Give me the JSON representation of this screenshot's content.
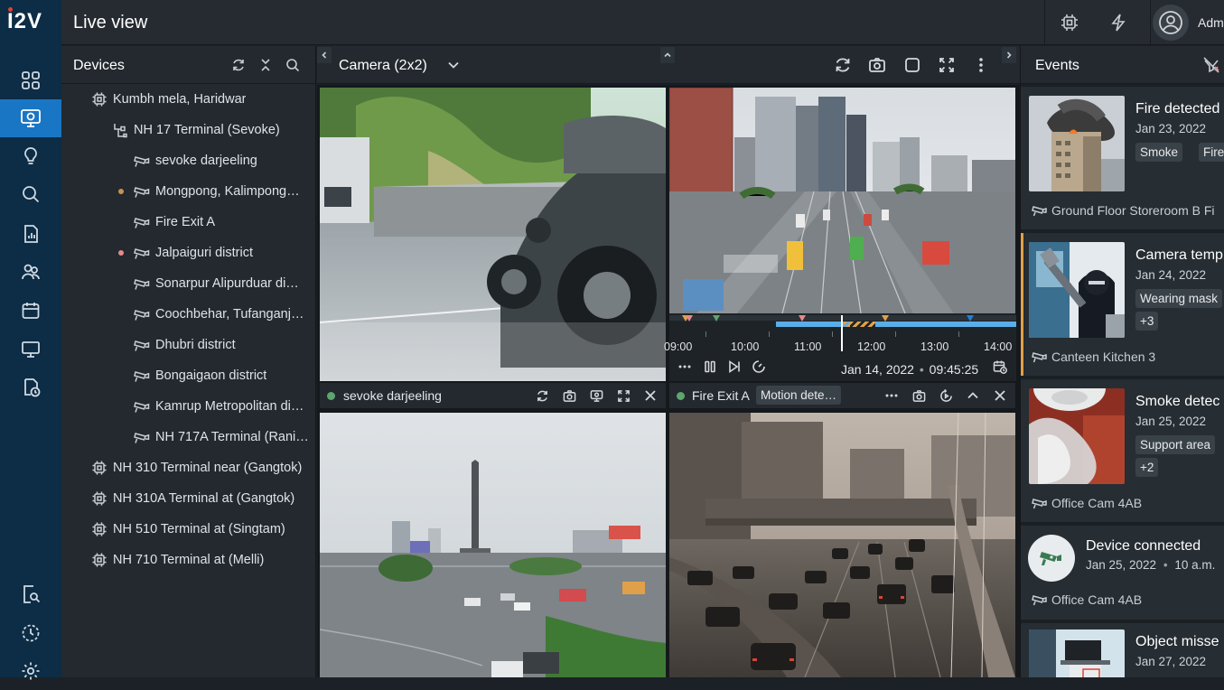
{
  "app": {
    "logo": "I2V",
    "title": "Live view",
    "user": "Adm"
  },
  "colors": {
    "rail": "#0d2c45",
    "active": "#1976c4",
    "panel": "#23292f",
    "accent_orange": "#e0a14a",
    "status_green": "#5fa56e",
    "timeline_blue": "#5aaee8"
  },
  "rail": {
    "top": [
      "grid-icon",
      "live-view-icon",
      "bulb-icon",
      "search-icon",
      "report-icon",
      "users-icon",
      "calendar-icon",
      "monitor-icon",
      "history-icon"
    ],
    "bottom": [
      "search-doc-icon",
      "clock-icon",
      "settings-icon"
    ]
  },
  "devices": {
    "title": "Devices",
    "tree": [
      {
        "label": "Kumbh mela, Haridwar",
        "icon": "site-icon",
        "level": 0
      },
      {
        "label": "NH 17 Terminal (Sevoke)",
        "icon": "branch-icon",
        "level": 1
      },
      {
        "label": "sevoke darjeeling",
        "icon": "camera-icon",
        "level": 2
      },
      {
        "label": "Mongpong, Kalimpong…",
        "icon": "camera-icon",
        "level": 2,
        "status": "#c8924e"
      },
      {
        "label": "Fire Exit A",
        "icon": "camera-icon",
        "level": 2
      },
      {
        "label": "Jalpaiguri district",
        "icon": "camera-icon",
        "level": 2,
        "status": "#e58a8a"
      },
      {
        "label": "Sonarpur Alipurduar di…",
        "icon": "camera-icon",
        "level": 2
      },
      {
        "label": "Coochbehar, Tufanganj…",
        "icon": "camera-icon",
        "level": 2
      },
      {
        "label": "Dhubri district",
        "icon": "camera-icon",
        "level": 2
      },
      {
        "label": "Bongaigaon district",
        "icon": "camera-icon",
        "level": 2
      },
      {
        "label": "Kamrup Metropolitan di…",
        "icon": "camera-icon",
        "level": 2
      },
      {
        "label": "NH 717A Terminal (Rani…",
        "icon": "camera-icon",
        "level": 2
      },
      {
        "label": "NH 310 Terminal near (Gangtok)",
        "icon": "site-icon",
        "level": 0
      },
      {
        "label": "NH 310A Terminal at (Gangtok)",
        "icon": "site-icon",
        "level": 0
      },
      {
        "label": "NH 510 Terminal at (Singtam)",
        "icon": "site-icon",
        "level": 0
      },
      {
        "label": "NH 710 Terminal at (Melli)",
        "icon": "site-icon",
        "level": 0
      }
    ]
  },
  "view": {
    "layout_label": "Camera (2x2)",
    "tiles": [
      {
        "name": "sevoke darjeeling",
        "status": "online"
      },
      {
        "name": "Fire Exit A",
        "event_chip": "Motion dete…",
        "status": "online"
      },
      {
        "name": "",
        "status": "online"
      },
      {
        "name": "",
        "status": "online"
      }
    ],
    "timeline": {
      "hours": [
        "09:00",
        "10:00",
        "11:00",
        "12:00",
        "13:00",
        "14:00"
      ],
      "date": "Jan 14, 2022",
      "time": "09:45:25",
      "separator": "•"
    }
  },
  "events": {
    "title": "Events",
    "items": [
      {
        "title": "Fire detected",
        "date": "Jan 23, 2022",
        "tags": [
          "Smoke",
          "Fire"
        ],
        "location": "Ground Floor Storeroom B Fi",
        "thumb": "fire-building"
      },
      {
        "title": "Camera temp",
        "date": "Jan 24, 2022",
        "tags": [
          "Wearing mask",
          "+3"
        ],
        "location": "Canteen Kitchen 3",
        "thumb": "masked-person",
        "accent": true
      },
      {
        "title": "Smoke detec",
        "date": "Jan 25, 2022",
        "tags": [
          "Support area",
          "+2"
        ],
        "location": "Office Cam 4AB",
        "thumb": "smoke-detector"
      },
      {
        "title": "Device connected",
        "date": "Jan 25, 2022",
        "time": "10 a.m.",
        "separator": "•",
        "location": "Office Cam 4AB",
        "thumb": "cctv-icon"
      },
      {
        "title": "Object misse",
        "date": "Jan 27, 2022",
        "thumb": "laptop-desk"
      }
    ]
  }
}
